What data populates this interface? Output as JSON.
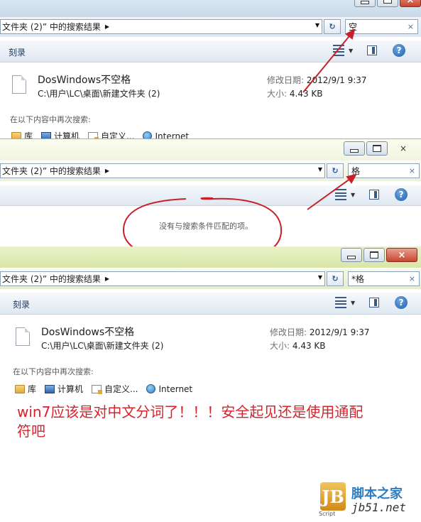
{
  "panels": [
    {
      "address_text": "文件夹 (2)” 中的搜索结果",
      "search_value": "空",
      "toolbar_label": "刻录",
      "result": {
        "name": "DosWindows不空格",
        "path": "C:\\用户\\LC\\桌面\\新建文件夹 (2)",
        "modified_label": "修改日期:",
        "modified_value": "2012/9/1 9:37",
        "size_label": "大小:",
        "size_value": "4.43 KB"
      },
      "search_again_label": "在以下内容中再次搜索:",
      "search_locations": [
        "库",
        "计算机",
        "自定义...",
        "Internet"
      ]
    },
    {
      "address_text": "文件夹 (2)” 中的搜索结果",
      "search_value": "格",
      "no_match_text": "没有与搜索条件匹配的项。"
    },
    {
      "address_text": "文件夹 (2)” 中的搜索结果",
      "search_value": "*格",
      "toolbar_label": "刻录",
      "result": {
        "name": "DosWindows不空格",
        "path": "C:\\用户\\LC\\桌面\\新建文件夹 (2)",
        "modified_label": "修改日期:",
        "modified_value": "2012/9/1 9:37",
        "size_label": "大小:",
        "size_value": "4.43 KB"
      },
      "search_again_label": "在以下内容中再次搜索:",
      "search_locations": [
        "库",
        "计算机",
        "自定义...",
        "Internet"
      ]
    }
  ],
  "annotation": {
    "line1": "win7应该是对中文分词了！！！安全起见还是使用通配",
    "line2": "符吧",
    "color": "#d8222b"
  },
  "watermark": {
    "letters": "JB",
    "sub": "Script",
    "name": "脚本之家",
    "url": "jb51.net"
  },
  "icons": {
    "clear": "×",
    "help": "?",
    "refresh": "↻"
  }
}
